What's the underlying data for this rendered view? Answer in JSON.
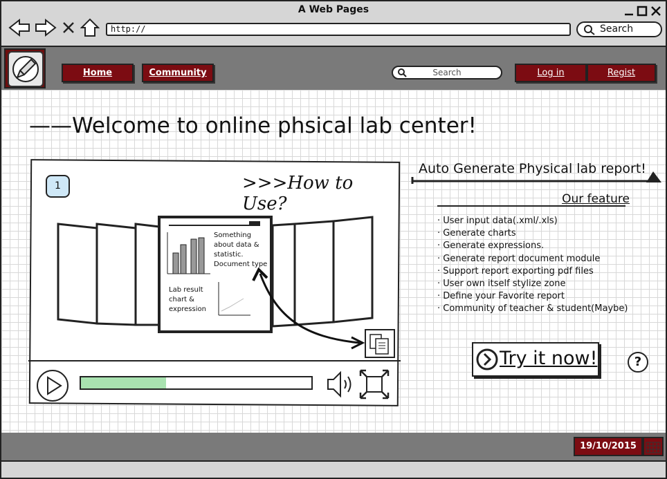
{
  "window": {
    "title": "A Web Pages"
  },
  "browser": {
    "url": "http://",
    "search_label": "Search"
  },
  "header": {
    "nav": [
      {
        "label": "Home"
      },
      {
        "label": "Community"
      }
    ],
    "search_placeholder": "Search",
    "login_label": "Log in",
    "register_label": "Regist"
  },
  "main": {
    "welcome": "——Welcome to online phsical lab center!",
    "video": {
      "step": "1",
      "heading": ">>>How to Use?",
      "slide_text_1": "Something about data & statistic. Document type",
      "slide_text_2": "Lab result chart & expression",
      "progress": 0.37
    },
    "features": {
      "banner": "Auto Generate Physical lab report!",
      "title": "Our feature",
      "items": [
        "· User input data(.xml/.xls)",
        "· Generate charts",
        "· Generate expressions.",
        "· Generate report document module",
        "· Support report exporting pdf files",
        "· User own itself stylize zone",
        "· Define your Favorite report",
        "· Community of teacher & student(Maybe)"
      ]
    },
    "try_label": "Try it now!",
    "help": "?"
  },
  "footer": {
    "date": "19/10/2015"
  },
  "colors": {
    "accent": "#7c0c12",
    "chrome": "#d6d6d6",
    "header": "#7a7a7a",
    "progress": "#a9e2b0",
    "badge": "#cfe8f7"
  },
  "icons": [
    "back-arrow-icon",
    "forward-arrow-icon",
    "stop-icon",
    "home-icon",
    "search-icon",
    "logo-pen-icon",
    "play-icon",
    "volume-icon",
    "fullscreen-icon",
    "document-icon",
    "calendar-icon",
    "help-icon",
    "chevron-right-icon"
  ]
}
